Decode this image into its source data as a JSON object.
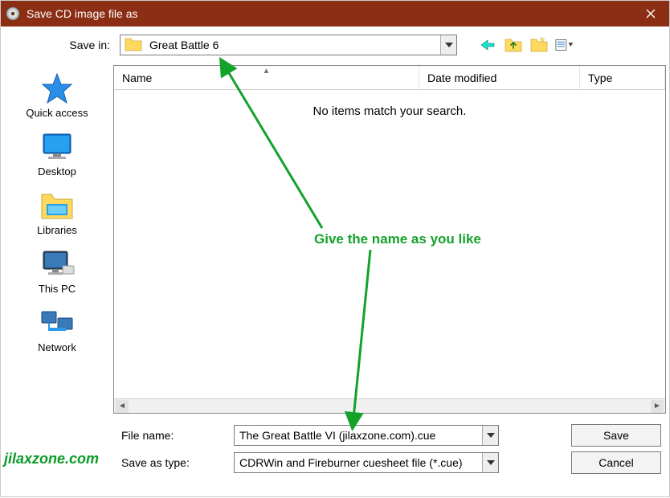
{
  "titlebar": {
    "title": "Save CD image file as"
  },
  "toprow": {
    "savein_label": "Save in:",
    "savein_value": "Great Battle 6"
  },
  "sidebar": {
    "items": [
      {
        "label": "Quick access"
      },
      {
        "label": "Desktop"
      },
      {
        "label": "Libraries"
      },
      {
        "label": "This PC"
      },
      {
        "label": "Network"
      }
    ]
  },
  "columns": {
    "name": "Name",
    "date": "Date modified",
    "type": "Type"
  },
  "list": {
    "empty_message": "No items match your search."
  },
  "bottom": {
    "filename_label": "File name:",
    "filename_value": "The Great Battle VI (jilaxzone.com).cue",
    "savetype_label": "Save as type:",
    "savetype_value": "CDRWin and Fireburner cuesheet file (*.cue)",
    "save_btn": "Save",
    "cancel_btn": "Cancel"
  },
  "annotation": {
    "text": "Give the name as you like"
  },
  "watermark": "jilaxzone.com"
}
